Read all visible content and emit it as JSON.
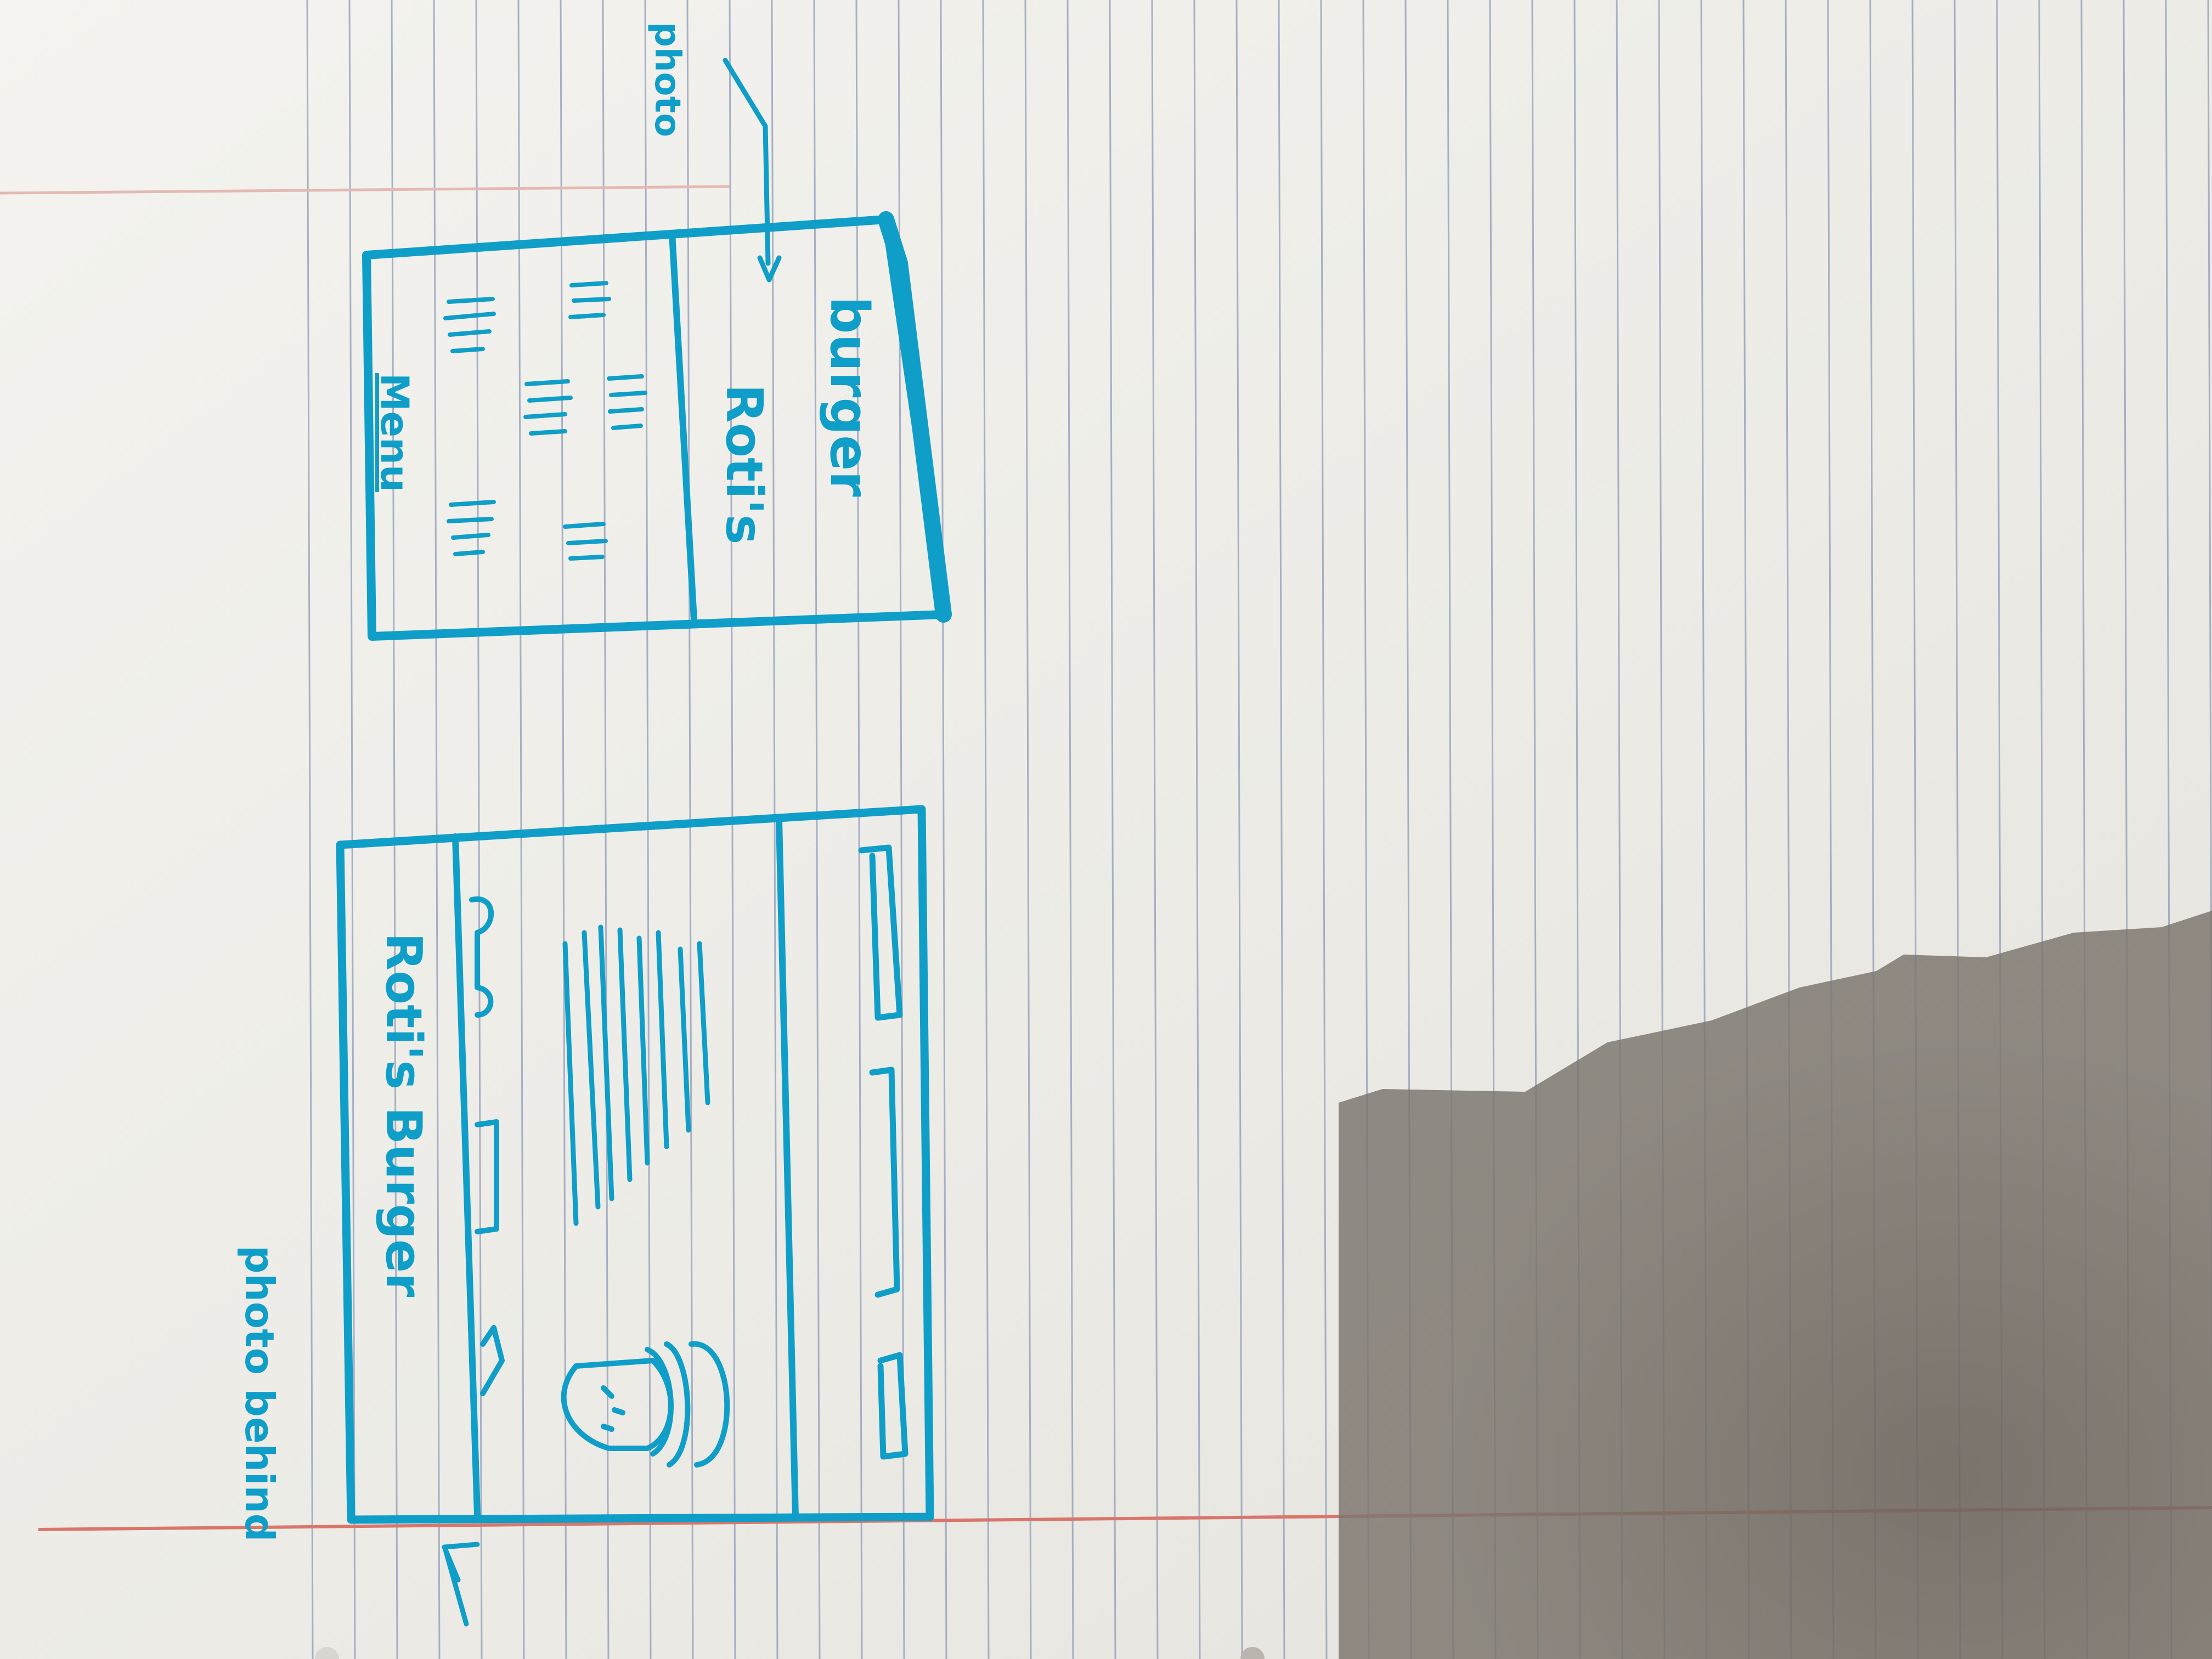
{
  "paper": {
    "paper_color": "#efeeea",
    "rule_color": "#8f9bb8",
    "margin_line_color": "#d9766c",
    "ink_color": "#0f9ec8",
    "shadow_color": "#6f6860"
  },
  "notes": {
    "photo_behind": "photo behind",
    "photo": "photo"
  },
  "left_sketch": {
    "title": "Roti's Burger",
    "burger_icon": "burger-icon"
  },
  "right_sketch": {
    "menu_heading": "Menu",
    "footer_line1": "Roti's",
    "footer_line2": "burger"
  }
}
